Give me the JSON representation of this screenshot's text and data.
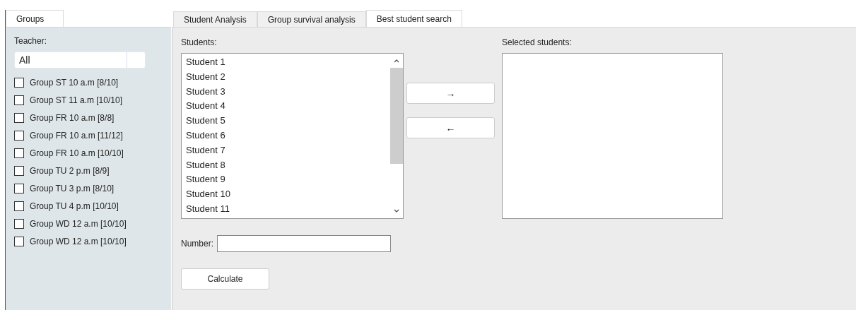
{
  "left_panel": {
    "tab": {
      "label": "Groups",
      "selected": true
    },
    "teacher_label": "Teacher:",
    "teacher_combo": {
      "value": "All"
    },
    "groups": [
      {
        "label": "Group ST 10 a.m [8/10]",
        "checked": false
      },
      {
        "label": "Group ST 11 a.m [10/10]",
        "checked": false
      },
      {
        "label": "Group FR 10 a.m [8/8]",
        "checked": false
      },
      {
        "label": "Group FR 10 a.m [11/12]",
        "checked": false
      },
      {
        "label": "Group FR 10 a.m [10/10]",
        "checked": false
      },
      {
        "label": "Group TU 2 p.m [8/9]",
        "checked": false
      },
      {
        "label": "Group TU 3 p.m [8/10]",
        "checked": false
      },
      {
        "label": "Group TU 4 p.m [10/10]",
        "checked": false
      },
      {
        "label": "Group WD 12 a.m [10/10]",
        "checked": false
      },
      {
        "label": "Group WD 12 a.m [10/10]",
        "checked": false
      }
    ]
  },
  "tabs": [
    {
      "label": "Student Analysis",
      "selected": false
    },
    {
      "label": "Group survival analysis",
      "selected": false
    },
    {
      "label": "Best student search",
      "selected": true
    }
  ],
  "students_label": "Students:",
  "students": [
    "Student 1",
    "Student 2",
    "Student 3",
    "Student 4",
    "Student 5",
    "Student 6",
    "Student 7",
    "Student 8",
    "Student 9",
    "Student 10",
    "Student 11"
  ],
  "move_buttons": [
    "→",
    "←"
  ],
  "selected_label": "Selected students:",
  "number_label": "Number:",
  "calculate_button": "Calculate"
}
